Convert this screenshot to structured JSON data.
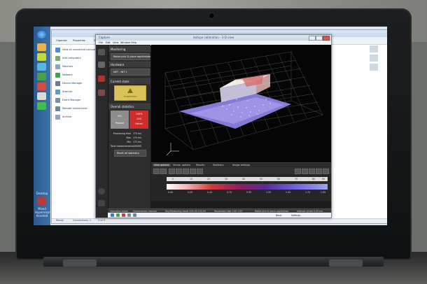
{
  "taskbar": {
    "items": [
      "Desktop",
      "Mixed Hypervisor Assisted"
    ]
  },
  "explorer": {
    "toolbar": [
      "Organize",
      "Properties",
      "Start"
    ],
    "items": [
      {
        "label": "View all connected computers"
      },
      {
        "label": "Add computers"
      },
      {
        "label": "Monitors"
      },
      {
        "label": "Network"
      },
      {
        "label": "Device Manager"
      },
      {
        "label": "Scanner"
      },
      {
        "label": "Event Manager"
      },
      {
        "label": "Remote connections"
      },
      {
        "label": "Archive"
      }
    ],
    "status": [
      "Ready",
      "Connections: 1",
      "2 of 9"
    ]
  },
  "app": {
    "title": "Isotope calibration - 3-D view",
    "logo": "Capture",
    "menu": [
      "File",
      "Edit",
      "View",
      "Window",
      "Help"
    ],
    "panel": {
      "monitoring": "Monitoring",
      "robot_button": "Robot pick & place application",
      "hardware": "Hardware",
      "hw_button": "NET - INT 1",
      "current_state": "Current state",
      "state_label": "Inspection",
      "overall": "Overall statistics",
      "passed_pct": "0%",
      "passed_lbl": "Passed",
      "failed_pct": "100%",
      "failed_count": "100",
      "failed_lbl": "Failed",
      "stats": [
        {
          "k": "Processing time",
          "v": "174 ms"
        },
        {
          "k": "Max",
          "v": "174 ms"
        },
        {
          "k": "Min",
          "v": "172 ms"
        },
        {
          "k": "Total measurements",
          "v": "100000"
        }
      ],
      "reset": "Reset all statistics"
    },
    "tabs": [
      "View options",
      "Sensor options",
      "Results",
      "Statistics",
      "Image settings"
    ],
    "colorbar": {
      "scale_ticks": [
        "0",
        "10",
        "20",
        "30",
        "40",
        "50",
        "60",
        "70",
        "80",
        "90"
      ],
      "labels": [
        "0.00",
        "0.20",
        "0.45",
        "0.70",
        "0.95",
        "1.20",
        "1.45",
        "1.70",
        "1.95"
      ]
    },
    "status": [
      "Operation mode",
      "Compression manual",
      "Key/Measuring mode  100.00  100.00",
      "Resolution rate  1.00  1.00",
      "Robot pick & place application",
      "Interval cycles  0.00 ms"
    ],
    "bottom_labels": [
      "Basic",
      "Settings"
    ]
  }
}
